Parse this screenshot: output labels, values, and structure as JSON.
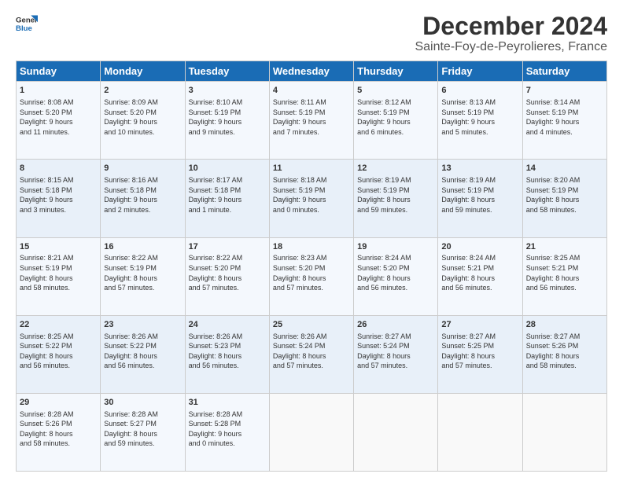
{
  "header": {
    "logo_line1": "General",
    "logo_line2": "Blue",
    "main_title": "December 2024",
    "subtitle": "Sainte-Foy-de-Peyrolieres, France"
  },
  "columns": [
    "Sunday",
    "Monday",
    "Tuesday",
    "Wednesday",
    "Thursday",
    "Friday",
    "Saturday"
  ],
  "weeks": [
    [
      {
        "day": "1",
        "lines": [
          "Sunrise: 8:08 AM",
          "Sunset: 5:20 PM",
          "Daylight: 9 hours",
          "and 11 minutes."
        ]
      },
      {
        "day": "2",
        "lines": [
          "Sunrise: 8:09 AM",
          "Sunset: 5:20 PM",
          "Daylight: 9 hours",
          "and 10 minutes."
        ]
      },
      {
        "day": "3",
        "lines": [
          "Sunrise: 8:10 AM",
          "Sunset: 5:19 PM",
          "Daylight: 9 hours",
          "and 9 minutes."
        ]
      },
      {
        "day": "4",
        "lines": [
          "Sunrise: 8:11 AM",
          "Sunset: 5:19 PM",
          "Daylight: 9 hours",
          "and 7 minutes."
        ]
      },
      {
        "day": "5",
        "lines": [
          "Sunrise: 8:12 AM",
          "Sunset: 5:19 PM",
          "Daylight: 9 hours",
          "and 6 minutes."
        ]
      },
      {
        "day": "6",
        "lines": [
          "Sunrise: 8:13 AM",
          "Sunset: 5:19 PM",
          "Daylight: 9 hours",
          "and 5 minutes."
        ]
      },
      {
        "day": "7",
        "lines": [
          "Sunrise: 8:14 AM",
          "Sunset: 5:19 PM",
          "Daylight: 9 hours",
          "and 4 minutes."
        ]
      }
    ],
    [
      {
        "day": "8",
        "lines": [
          "Sunrise: 8:15 AM",
          "Sunset: 5:18 PM",
          "Daylight: 9 hours",
          "and 3 minutes."
        ]
      },
      {
        "day": "9",
        "lines": [
          "Sunrise: 8:16 AM",
          "Sunset: 5:18 PM",
          "Daylight: 9 hours",
          "and 2 minutes."
        ]
      },
      {
        "day": "10",
        "lines": [
          "Sunrise: 8:17 AM",
          "Sunset: 5:18 PM",
          "Daylight: 9 hours",
          "and 1 minute."
        ]
      },
      {
        "day": "11",
        "lines": [
          "Sunrise: 8:18 AM",
          "Sunset: 5:19 PM",
          "Daylight: 9 hours",
          "and 0 minutes."
        ]
      },
      {
        "day": "12",
        "lines": [
          "Sunrise: 8:19 AM",
          "Sunset: 5:19 PM",
          "Daylight: 8 hours",
          "and 59 minutes."
        ]
      },
      {
        "day": "13",
        "lines": [
          "Sunrise: 8:19 AM",
          "Sunset: 5:19 PM",
          "Daylight: 8 hours",
          "and 59 minutes."
        ]
      },
      {
        "day": "14",
        "lines": [
          "Sunrise: 8:20 AM",
          "Sunset: 5:19 PM",
          "Daylight: 8 hours",
          "and 58 minutes."
        ]
      }
    ],
    [
      {
        "day": "15",
        "lines": [
          "Sunrise: 8:21 AM",
          "Sunset: 5:19 PM",
          "Daylight: 8 hours",
          "and 58 minutes."
        ]
      },
      {
        "day": "16",
        "lines": [
          "Sunrise: 8:22 AM",
          "Sunset: 5:19 PM",
          "Daylight: 8 hours",
          "and 57 minutes."
        ]
      },
      {
        "day": "17",
        "lines": [
          "Sunrise: 8:22 AM",
          "Sunset: 5:20 PM",
          "Daylight: 8 hours",
          "and 57 minutes."
        ]
      },
      {
        "day": "18",
        "lines": [
          "Sunrise: 8:23 AM",
          "Sunset: 5:20 PM",
          "Daylight: 8 hours",
          "and 57 minutes."
        ]
      },
      {
        "day": "19",
        "lines": [
          "Sunrise: 8:24 AM",
          "Sunset: 5:20 PM",
          "Daylight: 8 hours",
          "and 56 minutes."
        ]
      },
      {
        "day": "20",
        "lines": [
          "Sunrise: 8:24 AM",
          "Sunset: 5:21 PM",
          "Daylight: 8 hours",
          "and 56 minutes."
        ]
      },
      {
        "day": "21",
        "lines": [
          "Sunrise: 8:25 AM",
          "Sunset: 5:21 PM",
          "Daylight: 8 hours",
          "and 56 minutes."
        ]
      }
    ],
    [
      {
        "day": "22",
        "lines": [
          "Sunrise: 8:25 AM",
          "Sunset: 5:22 PM",
          "Daylight: 8 hours",
          "and 56 minutes."
        ]
      },
      {
        "day": "23",
        "lines": [
          "Sunrise: 8:26 AM",
          "Sunset: 5:22 PM",
          "Daylight: 8 hours",
          "and 56 minutes."
        ]
      },
      {
        "day": "24",
        "lines": [
          "Sunrise: 8:26 AM",
          "Sunset: 5:23 PM",
          "Daylight: 8 hours",
          "and 56 minutes."
        ]
      },
      {
        "day": "25",
        "lines": [
          "Sunrise: 8:26 AM",
          "Sunset: 5:24 PM",
          "Daylight: 8 hours",
          "and 57 minutes."
        ]
      },
      {
        "day": "26",
        "lines": [
          "Sunrise: 8:27 AM",
          "Sunset: 5:24 PM",
          "Daylight: 8 hours",
          "and 57 minutes."
        ]
      },
      {
        "day": "27",
        "lines": [
          "Sunrise: 8:27 AM",
          "Sunset: 5:25 PM",
          "Daylight: 8 hours",
          "and 57 minutes."
        ]
      },
      {
        "day": "28",
        "lines": [
          "Sunrise: 8:27 AM",
          "Sunset: 5:26 PM",
          "Daylight: 8 hours",
          "and 58 minutes."
        ]
      }
    ],
    [
      {
        "day": "29",
        "lines": [
          "Sunrise: 8:28 AM",
          "Sunset: 5:26 PM",
          "Daylight: 8 hours",
          "and 58 minutes."
        ]
      },
      {
        "day": "30",
        "lines": [
          "Sunrise: 8:28 AM",
          "Sunset: 5:27 PM",
          "Daylight: 8 hours",
          "and 59 minutes."
        ]
      },
      {
        "day": "31",
        "lines": [
          "Sunrise: 8:28 AM",
          "Sunset: 5:28 PM",
          "Daylight: 9 hours",
          "and 0 minutes."
        ]
      },
      null,
      null,
      null,
      null
    ]
  ]
}
